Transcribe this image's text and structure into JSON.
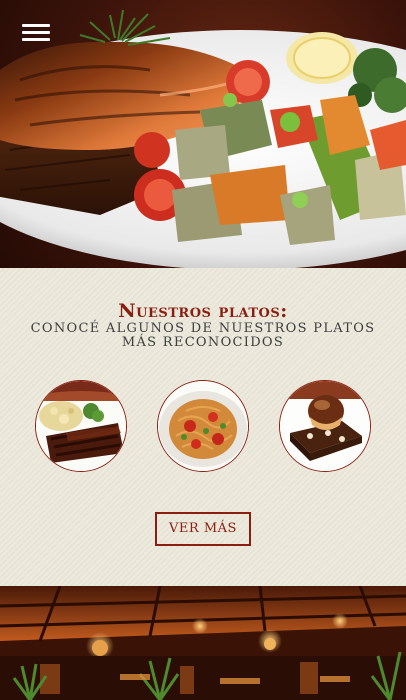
{
  "nav": {
    "menu_icon": "hamburger-menu-icon"
  },
  "hero": {
    "image": "grilled-salmon-with-vegetables"
  },
  "dishes_section": {
    "title": "Nuestros platos:",
    "subtitle": "CONOCÉ ALGUNOS DE NUESTROS PLATOS MÁS RECONOCIDOS",
    "dishes": [
      {
        "image": "ribs-with-potato-salad"
      },
      {
        "image": "pasta-with-tomatoes"
      },
      {
        "image": "chocolate-dessert"
      }
    ],
    "button_label": "VER MÁS"
  },
  "restaurant_section": {
    "image": "restaurant-interior"
  },
  "colors": {
    "accent": "#8a1e10",
    "section_bg": "#ebe8da",
    "subtitle_text": "#3d3d3d"
  }
}
